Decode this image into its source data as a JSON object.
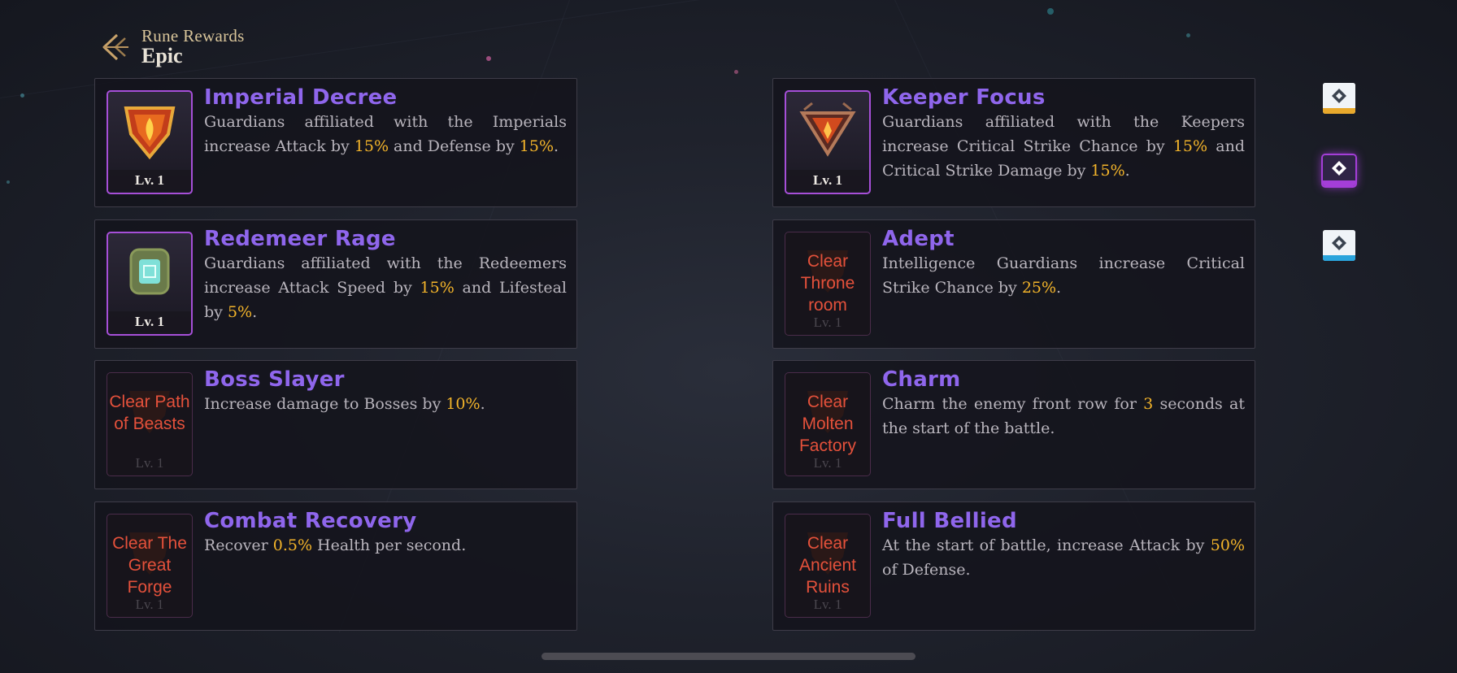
{
  "header": {
    "label": "Rune Rewards",
    "title": "Epic"
  },
  "cards": [
    {
      "title": "Imperial Decree",
      "desc": [
        {
          "t": "Guardians affiliated with the Imperials increase Attack by "
        },
        {
          "t": "15%",
          "hl": true
        },
        {
          "t": " and Defense by "
        },
        {
          "t": "15%",
          "hl": true
        },
        {
          "t": "."
        }
      ],
      "level": "Lv. 1",
      "locked": false,
      "lock_text": "",
      "icon": "imperial-rune-icon"
    },
    {
      "title": "Keeper Focus",
      "desc": [
        {
          "t": "Guardians affiliated with the Keepers increase Critical Strike Chance by "
        },
        {
          "t": "15%",
          "hl": true
        },
        {
          "t": " and Critical Strike Damage by "
        },
        {
          "t": "15%",
          "hl": true
        },
        {
          "t": "."
        }
      ],
      "level": "Lv. 1",
      "locked": false,
      "lock_text": "",
      "icon": "keeper-rune-icon"
    },
    {
      "title": "Redemeer Rage",
      "desc": [
        {
          "t": "Guardians affiliated with the Redeemers increase Attack Speed by "
        },
        {
          "t": "15%",
          "hl": true
        },
        {
          "t": " and Lifesteal by "
        },
        {
          "t": "5%",
          "hl": true
        },
        {
          "t": "."
        }
      ],
      "level": "Lv. 1",
      "locked": false,
      "lock_text": "",
      "icon": "redeemer-rune-icon"
    },
    {
      "title": "Adept",
      "desc": [
        {
          "t": "Intelligence Guardians increase Critical Strike Chance by "
        },
        {
          "t": "25%",
          "hl": true
        },
        {
          "t": "."
        }
      ],
      "level": "Lv. 1",
      "locked": true,
      "lock_text": "Clear Throne room",
      "icon": "adept-rune-icon"
    },
    {
      "title": "Boss Slayer",
      "desc": [
        {
          "t": "Increase damage to Bosses by "
        },
        {
          "t": "10%",
          "hl": true
        },
        {
          "t": "."
        }
      ],
      "level": "Lv. 1",
      "locked": true,
      "lock_text": "Clear Path of Beasts",
      "icon": "boss-slayer-rune-icon"
    },
    {
      "title": "Charm",
      "desc": [
        {
          "t": "Charm the enemy front row for "
        },
        {
          "t": "3",
          "hl": true
        },
        {
          "t": " seconds at the start of the battle."
        }
      ],
      "level": "Lv. 1",
      "locked": true,
      "lock_text": "Clear Molten Factory",
      "icon": "charm-rune-icon"
    },
    {
      "title": "Combat Recovery",
      "desc": [
        {
          "t": "Recover "
        },
        {
          "t": "0.5%",
          "hl": true
        },
        {
          "t": " Health per second."
        }
      ],
      "level": "Lv. 1",
      "locked": true,
      "lock_text": "Clear The Great Forge",
      "icon": "combat-recovery-rune-icon"
    },
    {
      "title": "Full Bellied",
      "desc": [
        {
          "t": "At the start of battle, increase Attack by "
        },
        {
          "t": "50%",
          "hl": true
        },
        {
          "t": " of Defense."
        }
      ],
      "level": "Lv. 1",
      "locked": true,
      "lock_text": "Clear Ancient Ruins",
      "icon": "full-bellied-rune-icon"
    }
  ],
  "tabs": [
    {
      "name": "legendary-tab",
      "color": "#e8a92c",
      "active": false
    },
    {
      "name": "epic-tab",
      "color": "#a43ed8",
      "active": true
    },
    {
      "name": "rare-tab",
      "color": "#2aa4dc",
      "active": false
    }
  ],
  "colors": {
    "title": "#8f66ec",
    "highlight": "#f3b42a",
    "lock": "#e4513b",
    "epic_border": "#a64fd8"
  }
}
